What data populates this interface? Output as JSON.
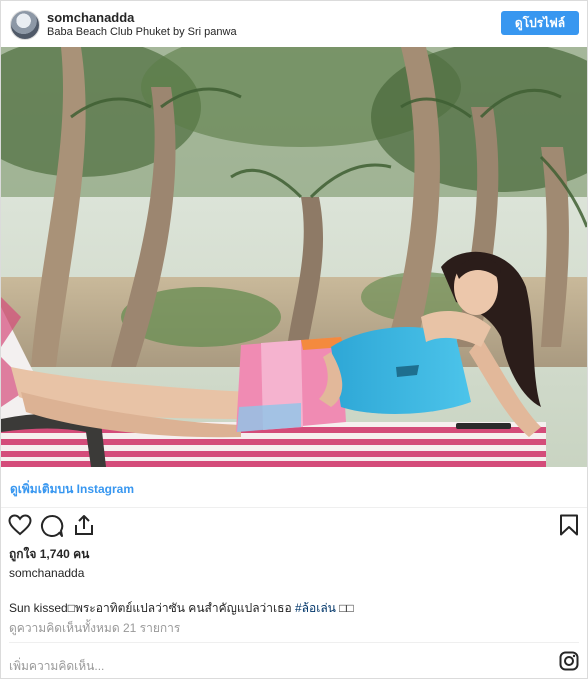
{
  "header": {
    "username": "somchanadda",
    "location": "Baba Beach Club Phuket by Sri panwa",
    "profile_button": "ดูโปรไฟล์"
  },
  "photo": {
    "description_icon": "photo"
  },
  "more_link": "ดูเพิ่มเติมบน Instagram",
  "actions": {
    "like_icon": "heart-icon",
    "comment_icon": "comment-icon",
    "share_icon": "share-icon",
    "save_icon": "bookmark-icon"
  },
  "likes": "ถูกใจ 1,740 คน",
  "author": "somchanadda",
  "caption": {
    "text": "Sun kissed□พระอาทิตย์แปลว่าซัน คนสำคัญแปลว่าเธอ ",
    "hashtag": "#ล้อเล่น",
    "trailing": " □□"
  },
  "comments_link": "ดูความคิดเห็นทั้งหมด 21 รายการ",
  "add_comment_placeholder": "เพิ่มความคิดเห็น...",
  "colors": {
    "accent": "#3897f0",
    "muted": "#999999",
    "text": "#262626"
  }
}
